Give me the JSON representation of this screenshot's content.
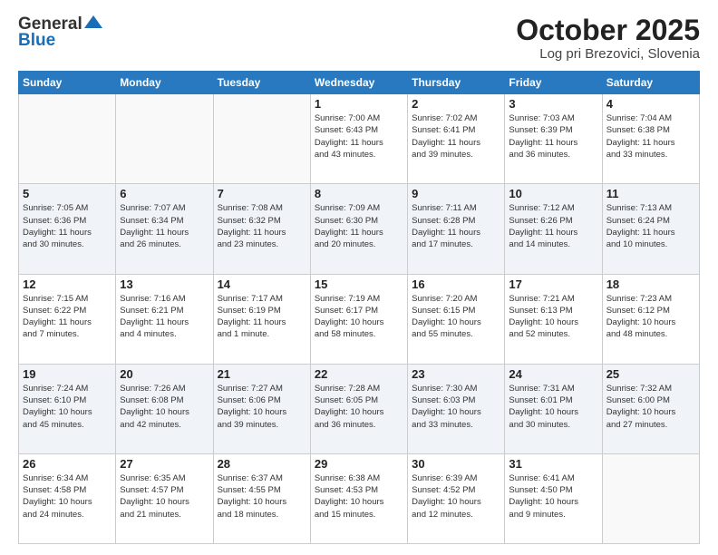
{
  "header": {
    "logo_line1": "General",
    "logo_line2": "Blue",
    "title": "October 2025",
    "subtitle": "Log pri Brezovici, Slovenia"
  },
  "days_of_week": [
    "Sunday",
    "Monday",
    "Tuesday",
    "Wednesday",
    "Thursday",
    "Friday",
    "Saturday"
  ],
  "weeks": [
    [
      {
        "day": "",
        "info": ""
      },
      {
        "day": "",
        "info": ""
      },
      {
        "day": "",
        "info": ""
      },
      {
        "day": "1",
        "info": "Sunrise: 7:00 AM\nSunset: 6:43 PM\nDaylight: 11 hours\nand 43 minutes."
      },
      {
        "day": "2",
        "info": "Sunrise: 7:02 AM\nSunset: 6:41 PM\nDaylight: 11 hours\nand 39 minutes."
      },
      {
        "day": "3",
        "info": "Sunrise: 7:03 AM\nSunset: 6:39 PM\nDaylight: 11 hours\nand 36 minutes."
      },
      {
        "day": "4",
        "info": "Sunrise: 7:04 AM\nSunset: 6:38 PM\nDaylight: 11 hours\nand 33 minutes."
      }
    ],
    [
      {
        "day": "5",
        "info": "Sunrise: 7:05 AM\nSunset: 6:36 PM\nDaylight: 11 hours\nand 30 minutes."
      },
      {
        "day": "6",
        "info": "Sunrise: 7:07 AM\nSunset: 6:34 PM\nDaylight: 11 hours\nand 26 minutes."
      },
      {
        "day": "7",
        "info": "Sunrise: 7:08 AM\nSunset: 6:32 PM\nDaylight: 11 hours\nand 23 minutes."
      },
      {
        "day": "8",
        "info": "Sunrise: 7:09 AM\nSunset: 6:30 PM\nDaylight: 11 hours\nand 20 minutes."
      },
      {
        "day": "9",
        "info": "Sunrise: 7:11 AM\nSunset: 6:28 PM\nDaylight: 11 hours\nand 17 minutes."
      },
      {
        "day": "10",
        "info": "Sunrise: 7:12 AM\nSunset: 6:26 PM\nDaylight: 11 hours\nand 14 minutes."
      },
      {
        "day": "11",
        "info": "Sunrise: 7:13 AM\nSunset: 6:24 PM\nDaylight: 11 hours\nand 10 minutes."
      }
    ],
    [
      {
        "day": "12",
        "info": "Sunrise: 7:15 AM\nSunset: 6:22 PM\nDaylight: 11 hours\nand 7 minutes."
      },
      {
        "day": "13",
        "info": "Sunrise: 7:16 AM\nSunset: 6:21 PM\nDaylight: 11 hours\nand 4 minutes."
      },
      {
        "day": "14",
        "info": "Sunrise: 7:17 AM\nSunset: 6:19 PM\nDaylight: 11 hours\nand 1 minute."
      },
      {
        "day": "15",
        "info": "Sunrise: 7:19 AM\nSunset: 6:17 PM\nDaylight: 10 hours\nand 58 minutes."
      },
      {
        "day": "16",
        "info": "Sunrise: 7:20 AM\nSunset: 6:15 PM\nDaylight: 10 hours\nand 55 minutes."
      },
      {
        "day": "17",
        "info": "Sunrise: 7:21 AM\nSunset: 6:13 PM\nDaylight: 10 hours\nand 52 minutes."
      },
      {
        "day": "18",
        "info": "Sunrise: 7:23 AM\nSunset: 6:12 PM\nDaylight: 10 hours\nand 48 minutes."
      }
    ],
    [
      {
        "day": "19",
        "info": "Sunrise: 7:24 AM\nSunset: 6:10 PM\nDaylight: 10 hours\nand 45 minutes."
      },
      {
        "day": "20",
        "info": "Sunrise: 7:26 AM\nSunset: 6:08 PM\nDaylight: 10 hours\nand 42 minutes."
      },
      {
        "day": "21",
        "info": "Sunrise: 7:27 AM\nSunset: 6:06 PM\nDaylight: 10 hours\nand 39 minutes."
      },
      {
        "day": "22",
        "info": "Sunrise: 7:28 AM\nSunset: 6:05 PM\nDaylight: 10 hours\nand 36 minutes."
      },
      {
        "day": "23",
        "info": "Sunrise: 7:30 AM\nSunset: 6:03 PM\nDaylight: 10 hours\nand 33 minutes."
      },
      {
        "day": "24",
        "info": "Sunrise: 7:31 AM\nSunset: 6:01 PM\nDaylight: 10 hours\nand 30 minutes."
      },
      {
        "day": "25",
        "info": "Sunrise: 7:32 AM\nSunset: 6:00 PM\nDaylight: 10 hours\nand 27 minutes."
      }
    ],
    [
      {
        "day": "26",
        "info": "Sunrise: 6:34 AM\nSunset: 4:58 PM\nDaylight: 10 hours\nand 24 minutes."
      },
      {
        "day": "27",
        "info": "Sunrise: 6:35 AM\nSunset: 4:57 PM\nDaylight: 10 hours\nand 21 minutes."
      },
      {
        "day": "28",
        "info": "Sunrise: 6:37 AM\nSunset: 4:55 PM\nDaylight: 10 hours\nand 18 minutes."
      },
      {
        "day": "29",
        "info": "Sunrise: 6:38 AM\nSunset: 4:53 PM\nDaylight: 10 hours\nand 15 minutes."
      },
      {
        "day": "30",
        "info": "Sunrise: 6:39 AM\nSunset: 4:52 PM\nDaylight: 10 hours\nand 12 minutes."
      },
      {
        "day": "31",
        "info": "Sunrise: 6:41 AM\nSunset: 4:50 PM\nDaylight: 10 hours\nand 9 minutes."
      },
      {
        "day": "",
        "info": ""
      }
    ]
  ]
}
